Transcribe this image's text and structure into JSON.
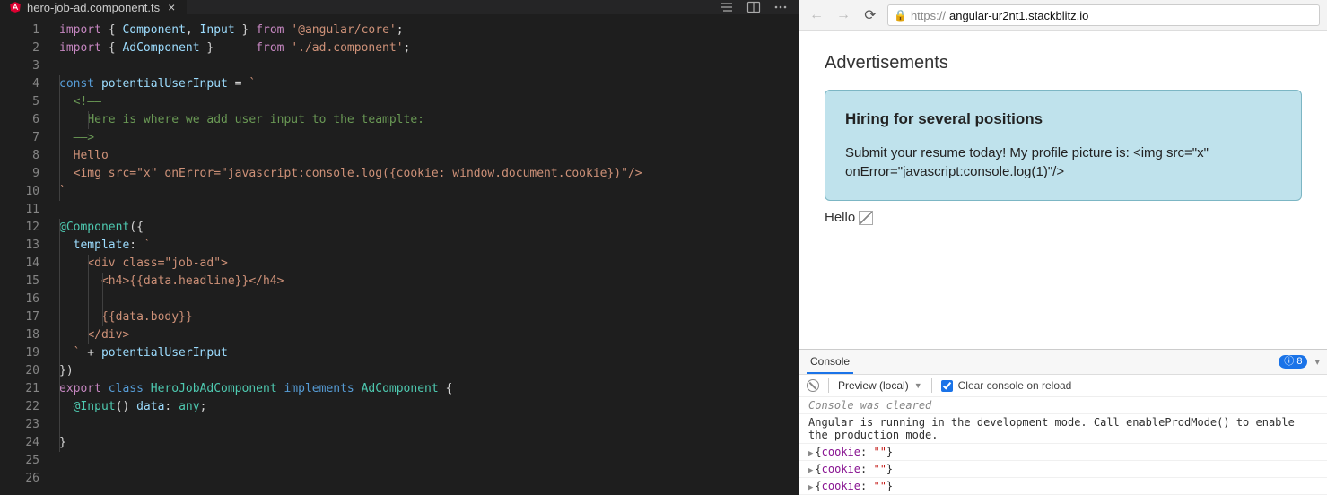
{
  "editor": {
    "tab_filename": "hero-job-ad.component.ts",
    "lines": [
      [
        {
          "c": "kw2",
          "t": "import"
        },
        {
          "c": "pun",
          "t": " { "
        },
        {
          "c": "var",
          "t": "Component"
        },
        {
          "c": "pun",
          "t": ", "
        },
        {
          "c": "var",
          "t": "Input"
        },
        {
          "c": "pun",
          "t": " } "
        },
        {
          "c": "kw2",
          "t": "from"
        },
        {
          "c": "pun",
          "t": " "
        },
        {
          "c": "str",
          "t": "'@angular/core'"
        },
        {
          "c": "pun",
          "t": ";"
        }
      ],
      [
        {
          "c": "kw2",
          "t": "import"
        },
        {
          "c": "pun",
          "t": " { "
        },
        {
          "c": "var",
          "t": "AdComponent"
        },
        {
          "c": "pun",
          "t": " }      "
        },
        {
          "c": "kw2",
          "t": "from"
        },
        {
          "c": "pun",
          "t": " "
        },
        {
          "c": "str",
          "t": "'./ad.component'"
        },
        {
          "c": "pun",
          "t": ";"
        }
      ],
      [],
      [
        {
          "c": "k",
          "t": "const"
        },
        {
          "c": "pun",
          "t": " "
        },
        {
          "c": "var",
          "t": "potentialUserInput"
        },
        {
          "c": "pun",
          "t": " = "
        },
        {
          "c": "str",
          "t": "`"
        }
      ],
      [
        {
          "c": "pun",
          "t": "  "
        },
        {
          "c": "cmt",
          "t": "<!––"
        }
      ],
      [
        {
          "c": "pun",
          "t": "    "
        },
        {
          "c": "cmt",
          "t": "Here is where we add user input to the teamplte:"
        }
      ],
      [
        {
          "c": "pun",
          "t": "  "
        },
        {
          "c": "cmt",
          "t": "––>"
        }
      ],
      [
        {
          "c": "pun",
          "t": "  "
        },
        {
          "c": "str",
          "t": "Hello"
        }
      ],
      [
        {
          "c": "pun",
          "t": "  "
        },
        {
          "c": "str",
          "t": "<img src=\"x\" onError=\"javascript:console.log({cookie: window.document.cookie})\"/>"
        }
      ],
      [
        {
          "c": "str",
          "t": "`"
        }
      ],
      [],
      [
        {
          "c": "dec",
          "t": "@Component"
        },
        {
          "c": "pun",
          "t": "({"
        }
      ],
      [
        {
          "c": "pun",
          "t": "  "
        },
        {
          "c": "var",
          "t": "template"
        },
        {
          "c": "pun",
          "t": ": "
        },
        {
          "c": "str",
          "t": "`"
        }
      ],
      [
        {
          "c": "pun",
          "t": "    "
        },
        {
          "c": "str",
          "t": "<div class=\"job-ad\">"
        }
      ],
      [
        {
          "c": "pun",
          "t": "      "
        },
        {
          "c": "str",
          "t": "<h4>{{data.headline}}</h4>"
        }
      ],
      [],
      [
        {
          "c": "pun",
          "t": "      "
        },
        {
          "c": "str",
          "t": "{{data.body}}"
        }
      ],
      [
        {
          "c": "pun",
          "t": "    "
        },
        {
          "c": "str",
          "t": "</div>"
        }
      ],
      [
        {
          "c": "pun",
          "t": "  "
        },
        {
          "c": "str",
          "t": "`"
        },
        {
          "c": "pun",
          "t": " + "
        },
        {
          "c": "var",
          "t": "potentialUserInput"
        }
      ],
      [
        {
          "c": "pun",
          "t": "})"
        }
      ],
      [
        {
          "c": "kw2",
          "t": "export"
        },
        {
          "c": "pun",
          "t": " "
        },
        {
          "c": "k",
          "t": "class"
        },
        {
          "c": "pun",
          "t": " "
        },
        {
          "c": "cls",
          "t": "HeroJobAdComponent"
        },
        {
          "c": "pun",
          "t": " "
        },
        {
          "c": "k",
          "t": "implements"
        },
        {
          "c": "pun",
          "t": " "
        },
        {
          "c": "cls",
          "t": "AdComponent"
        },
        {
          "c": "pun",
          "t": " {"
        }
      ],
      [
        {
          "c": "pun",
          "t": "  "
        },
        {
          "c": "dec",
          "t": "@Input"
        },
        {
          "c": "pun",
          "t": "() "
        },
        {
          "c": "var",
          "t": "data"
        },
        {
          "c": "pun",
          "t": ": "
        },
        {
          "c": "cls",
          "t": "any"
        },
        {
          "c": "pun",
          "t": ";"
        }
      ],
      [],
      [
        {
          "c": "pun",
          "t": "}"
        }
      ],
      [],
      []
    ]
  },
  "browser": {
    "url_scheme": "https://",
    "url_host": "angular-ur2nt1.stackblitz.io",
    "url_rest": "",
    "ads_title": "Advertisements",
    "ad_headline": "Hiring for several positions",
    "ad_body": "Submit your resume today! My profile picture is: <img src=\"x\" onError=\"javascript:console.log(1)\"/>",
    "hello_text": "Hello"
  },
  "console": {
    "tab_label": "Console",
    "badge_count": "8",
    "context": "Preview (local)",
    "clear_label": "Clear console on reload",
    "cleared": "Console was cleared",
    "angular_msg": "Angular is running in the development mode. Call enableProdMode() to enable the production mode.",
    "cookie_entries": [
      {
        "key": "cookie",
        "val": "\"\""
      },
      {
        "key": "cookie",
        "val": "\"\""
      },
      {
        "key": "cookie",
        "val": "\"\""
      }
    ]
  }
}
